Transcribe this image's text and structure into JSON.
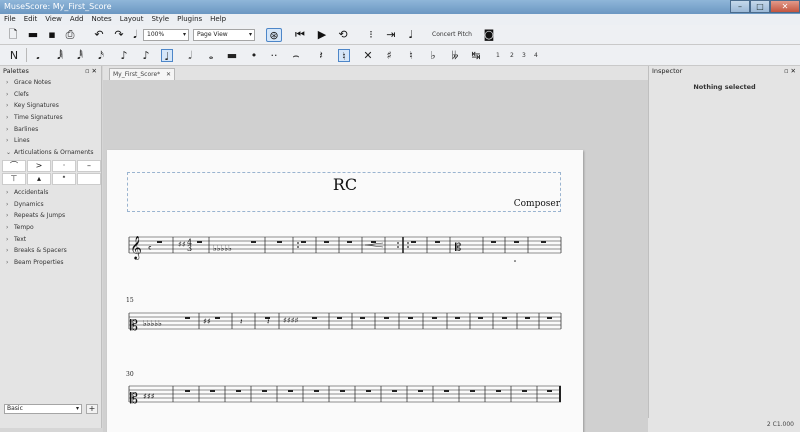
{
  "window": {
    "title": "MuseScore: My_First_Score",
    "controls": {
      "minimize": "–",
      "maximize": "□",
      "close": "✕"
    }
  },
  "menu": [
    "File",
    "Edit",
    "View",
    "Add",
    "Notes",
    "Layout",
    "Style",
    "Plugins",
    "Help"
  ],
  "toolbar": {
    "zoom": "100%",
    "view_mode": "Page View",
    "concert_pitch": "Concert Pitch",
    "voices": [
      "1",
      "2",
      "3",
      "4"
    ]
  },
  "palettes": {
    "header": "Palettes",
    "items": [
      {
        "label": "Grace Notes",
        "expanded": false
      },
      {
        "label": "Clefs",
        "expanded": false
      },
      {
        "label": "Key Signatures",
        "expanded": false
      },
      {
        "label": "Time Signatures",
        "expanded": false
      },
      {
        "label": "Barlines",
        "expanded": false
      },
      {
        "label": "Lines",
        "expanded": false
      },
      {
        "label": "Articulations & Ornaments",
        "expanded": true
      },
      {
        "label": "Accidentals",
        "expanded": false
      },
      {
        "label": "Dynamics",
        "expanded": false
      },
      {
        "label": "Repeats & Jumps",
        "expanded": false
      },
      {
        "label": "Tempo",
        "expanded": false
      },
      {
        "label": "Text",
        "expanded": false
      },
      {
        "label": "Breaks & Spacers",
        "expanded": false
      },
      {
        "label": "Beam Properties",
        "expanded": false
      }
    ],
    "articulation_cells": [
      "⌒",
      ">",
      "·",
      "–",
      "⊤",
      "▴",
      "𝆯",
      ""
    ],
    "workspace": "Basic",
    "add_label": "+"
  },
  "score": {
    "tab_label": "My_First_Score*",
    "title": "RC",
    "composer": "Composer",
    "measure_numbers": [
      "15",
      "30"
    ]
  },
  "inspector": {
    "header": "Inspector",
    "empty_text": "Nothing selected"
  },
  "status": {
    "position": "2 C1.000"
  },
  "colors": {
    "accent": "#4d86c8",
    "title_bar": "#7aa5cf"
  }
}
